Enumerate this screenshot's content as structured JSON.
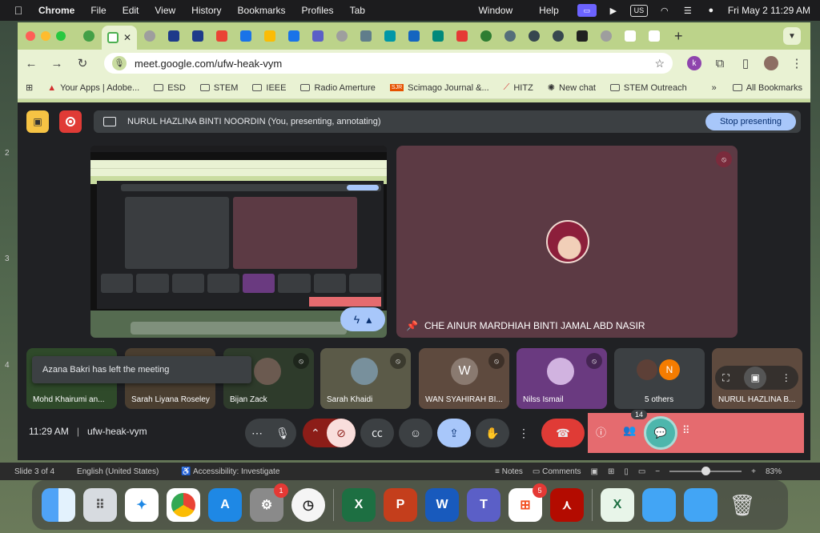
{
  "menubar": {
    "app": "Chrome",
    "items": [
      "File",
      "Edit",
      "View",
      "History",
      "Bookmarks",
      "Profiles",
      "Tab"
    ],
    "items_right": [
      "Window",
      "Help"
    ],
    "input_source": "US",
    "datetime": "Fri May 2  11:29 AM"
  },
  "browser": {
    "url": "meet.google.com/ufw-heak-vym",
    "profile_initial": "k",
    "bookmarks": [
      "Your Apps | Adobe...",
      "ESD",
      "STEM",
      "IEEE",
      "Radio Amerture",
      "Scimago Journal &...",
      "HITZ",
      "New chat",
      "STEM Outreach"
    ],
    "bookmarks_prefix_sjr": "SJR",
    "more": "»",
    "all_bookmarks": "All Bookmarks"
  },
  "meet": {
    "presenter_banner": "NURUL HAZLINA BINTI NOORDIN (You, presenting, annotating)",
    "stop_presenting": "Stop presenting",
    "speaker_name": "CHE AINUR MARDHIAH BINTI JAMAL ABD NASIR",
    "toast": "Azana Bakri has left the meeting",
    "participants": [
      {
        "name": "Mohd Khairumi an..."
      },
      {
        "name": "Sarah Liyana Roseley"
      },
      {
        "name": "Bijan Zack"
      },
      {
        "name": "Sarah Khaidi"
      },
      {
        "name": "WAN SYAHIRAH BI...",
        "initial": "W"
      },
      {
        "name": "Nilss Ismail"
      },
      {
        "name": "5 others",
        "initial": "N"
      },
      {
        "name": "NURUL HAZLINA B..."
      }
    ],
    "time": "11:29 AM",
    "meeting_code": "ufw-heak-vym",
    "people_count": "14"
  },
  "ppt_status": {
    "slide": "Slide 3 of 4",
    "language": "English (United States)",
    "accessibility": "Accessibility: Investigate",
    "notes": "Notes",
    "comments": "Comments",
    "zoom": "83%"
  },
  "ruler_numbers": [
    "2",
    "3",
    "4"
  ],
  "dock": {
    "settings_badge": "1",
    "store_badge": "5"
  }
}
